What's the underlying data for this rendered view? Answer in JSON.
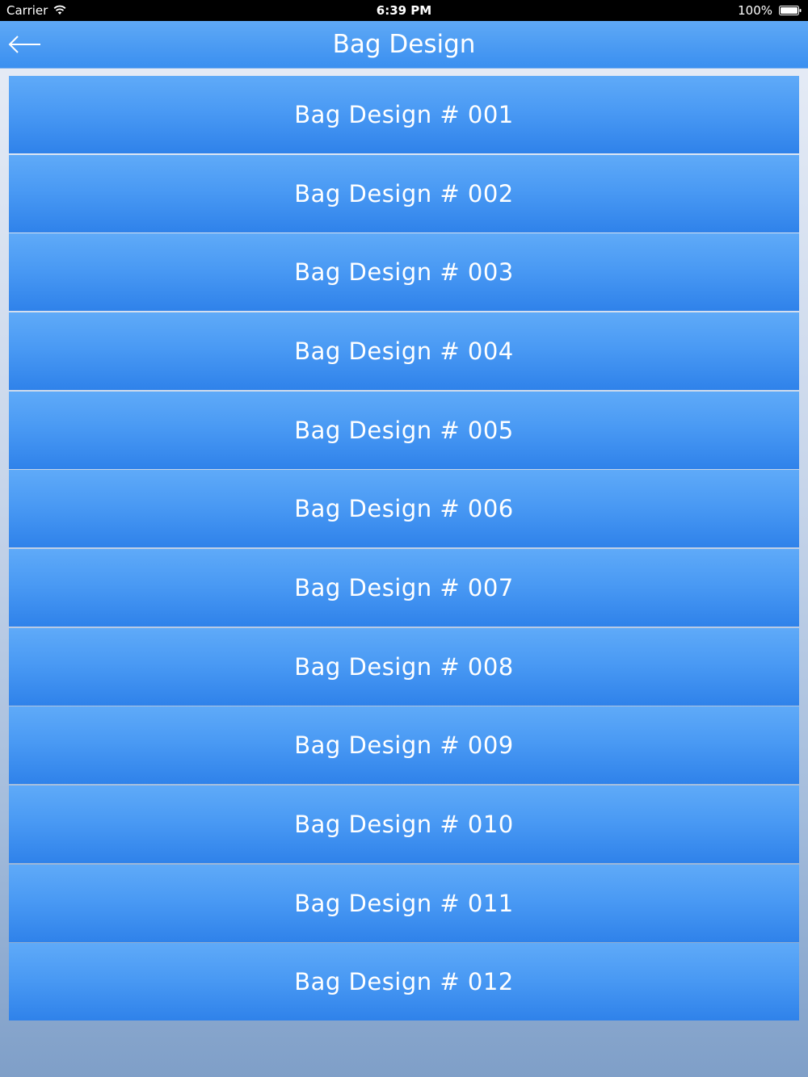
{
  "status_bar": {
    "carrier": "Carrier",
    "time": "6:39 PM",
    "battery": "100%"
  },
  "nav": {
    "title": "Bag Design",
    "back_icon": "arrow-left-icon"
  },
  "designs": [
    "Bag Design # 001",
    "Bag Design # 002",
    "Bag Design # 003",
    "Bag Design # 004",
    "Bag Design # 005",
    "Bag Design # 006",
    "Bag Design # 007",
    "Bag Design # 008",
    "Bag Design # 009",
    "Bag Design # 010",
    "Bag Design # 011",
    "Bag Design # 012"
  ],
  "colors": {
    "accent": "#3a8ff0",
    "status_bar": "#000000"
  }
}
